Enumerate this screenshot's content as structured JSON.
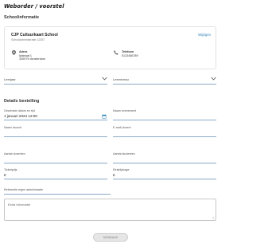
{
  "page": {
    "title": "Weborder / voorstel"
  },
  "sections": {
    "school": "Schoolinformatie",
    "order": "Details bestelling"
  },
  "school_card": {
    "name": "CJP Cultuurkaart School",
    "id_line": "Schooladministratie 12357",
    "change_link": "Wijzigen",
    "address_label": "Adres",
    "address_line1": "Ijsstraat 1",
    "address_line2": "1000TH Amsterdam",
    "phone_label": "Telefoon",
    "phone_value": "0123456789"
  },
  "selects": [
    {
      "placeholder": "Leerjaar"
    },
    {
      "placeholder": "Leerniveau"
    }
  ],
  "fields": {
    "date_label": "Gewenste datum en tijd",
    "date_value": "1 januari 2024 12:00",
    "event_label": "Naam evenement",
    "teacher_name_label": "Naam docent",
    "teacher_email_label": "E-mail docent",
    "num_teachers_label": "Aantal docenten",
    "num_students_label": "Aantal studenten",
    "ticket_price_label": "Ticketprijs",
    "ticket_price_value": "€",
    "extra_price_label": "Reisbijdrage",
    "extra_price_value": "€",
    "reference_label": "Referentie eigen administratie",
    "extra_info_placeholder": "Extra informatie"
  },
  "submit_label": "Versturen",
  "icons": [
    "location-pin-icon",
    "phone-icon",
    "chevron-down-icon",
    "calendar-icon",
    "resize-grip-icon"
  ],
  "colors": {
    "accent": "#2a7fb8",
    "field_border": "#8aa9c6"
  }
}
